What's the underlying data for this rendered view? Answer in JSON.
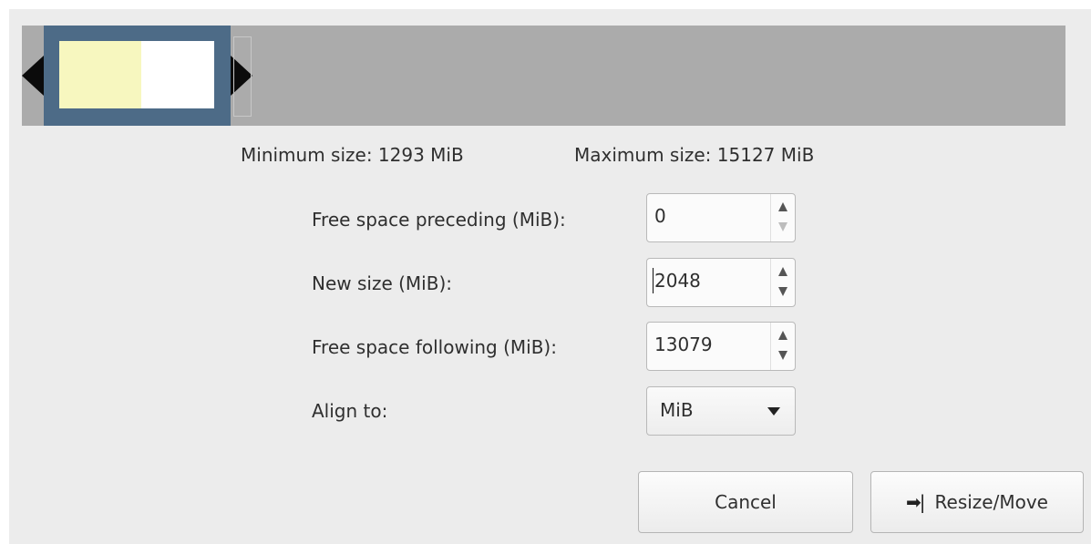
{
  "visualizer": {
    "colors": {
      "background": "#ababab",
      "partition_border": "#4d6b87",
      "used": "#f7f7bf",
      "unused": "#ffffff"
    }
  },
  "limits": {
    "min_label": "Minimum size: 1293 MiB",
    "max_label": "Maximum size: 15127 MiB"
  },
  "fields": {
    "preceding": {
      "label": "Free space preceding (MiB):",
      "value": "0"
    },
    "new_size": {
      "label": "New size (MiB):",
      "value": "2048"
    },
    "following": {
      "label": "Free space following (MiB):",
      "value": "13079"
    },
    "align": {
      "label": "Align to:",
      "value": "MiB"
    }
  },
  "buttons": {
    "cancel": "Cancel",
    "resize": "Resize/Move",
    "resize_icon": "resize-move-icon"
  }
}
